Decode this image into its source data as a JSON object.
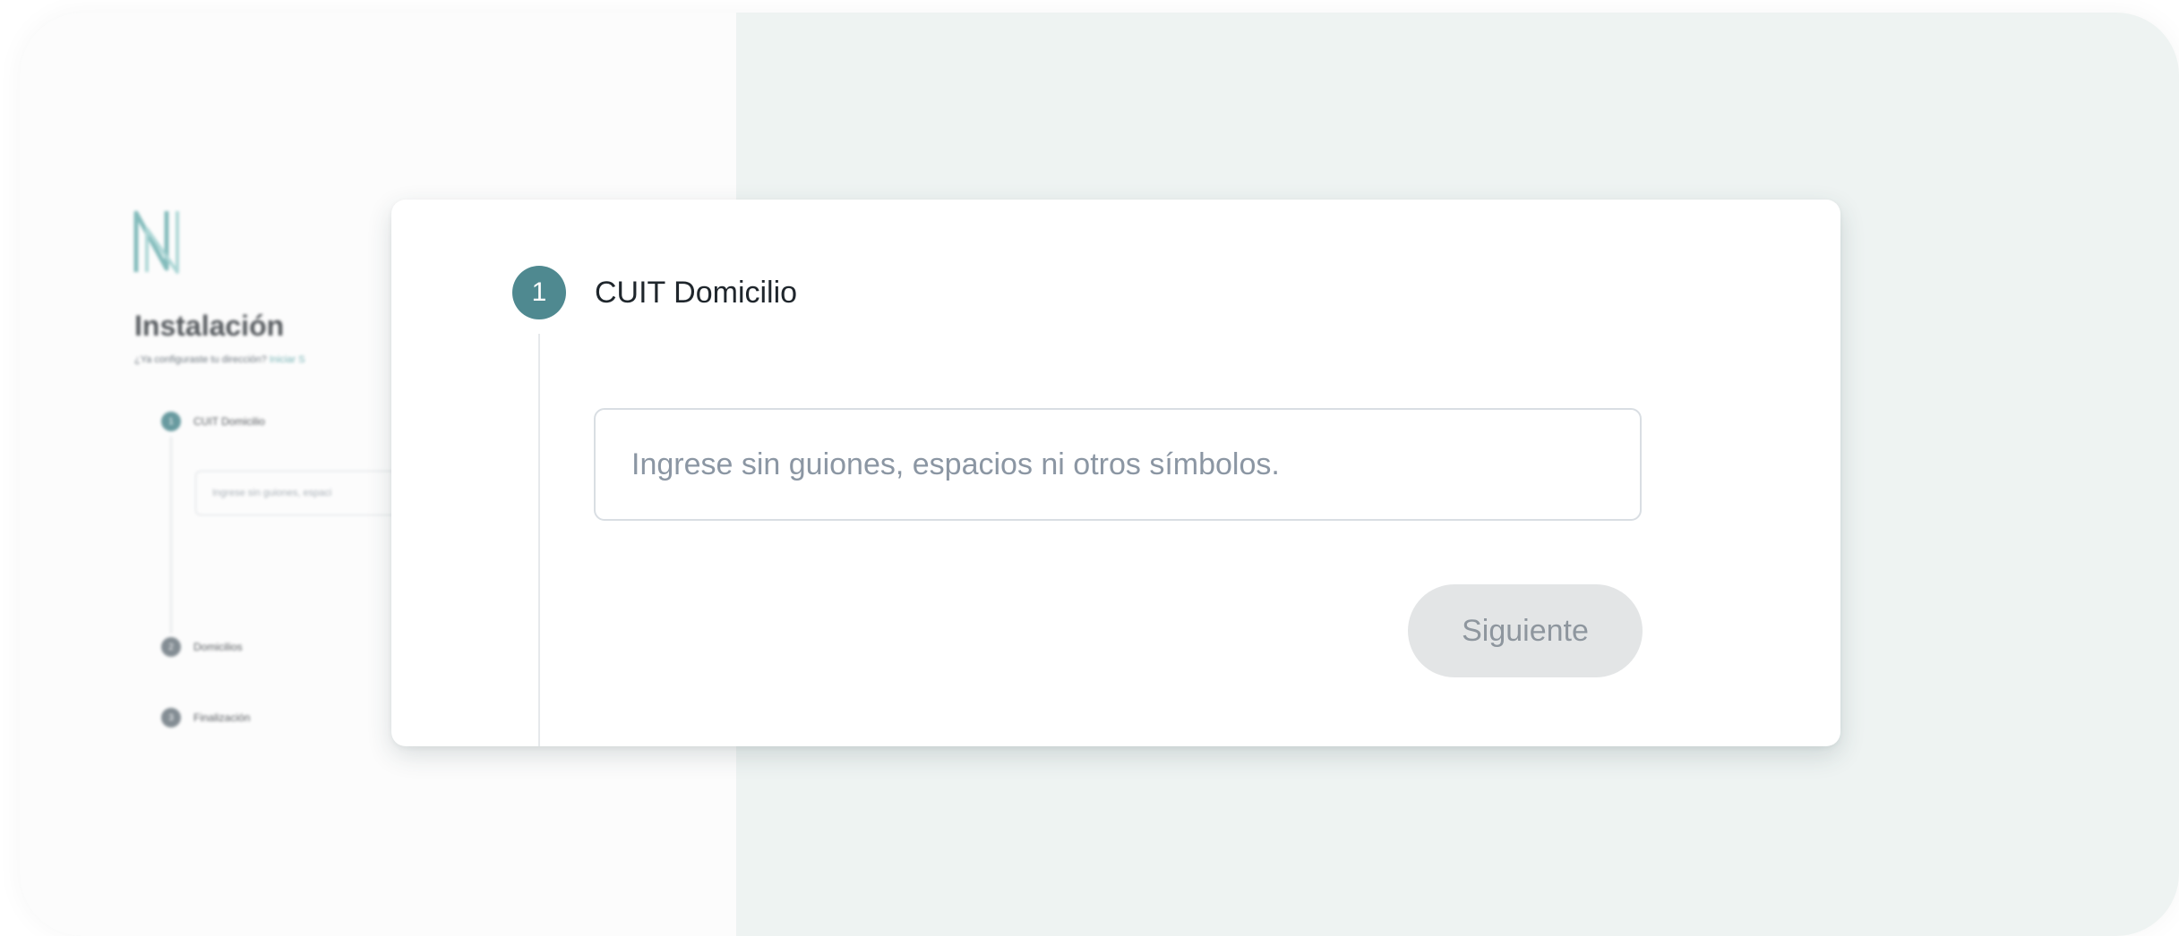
{
  "background": {
    "title": "Instalación",
    "subtitle": "¿Ya configuraste tu dirección?",
    "subtitle_link": "Iniciar S",
    "steps": [
      {
        "number": "1",
        "label": "CUIT Domicilio"
      },
      {
        "number": "2",
        "label": "Domicilios"
      },
      {
        "number": "3",
        "label": "Finalización"
      }
    ],
    "input_placeholder": "Ingrese sin guiones, espaci"
  },
  "card": {
    "step_number": "1",
    "step_title": "CUIT Domicilio",
    "input_value": "",
    "input_placeholder": "Ingrese sin guiones, espacios ni otros símbolos.",
    "next_label": "Siguiente"
  },
  "colors": {
    "accent": "#4f8990",
    "button_disabled_bg": "#e3e5e6",
    "right_panel_bg": "#eef3f2"
  },
  "icons": {
    "logo": "n-logo-icon"
  }
}
